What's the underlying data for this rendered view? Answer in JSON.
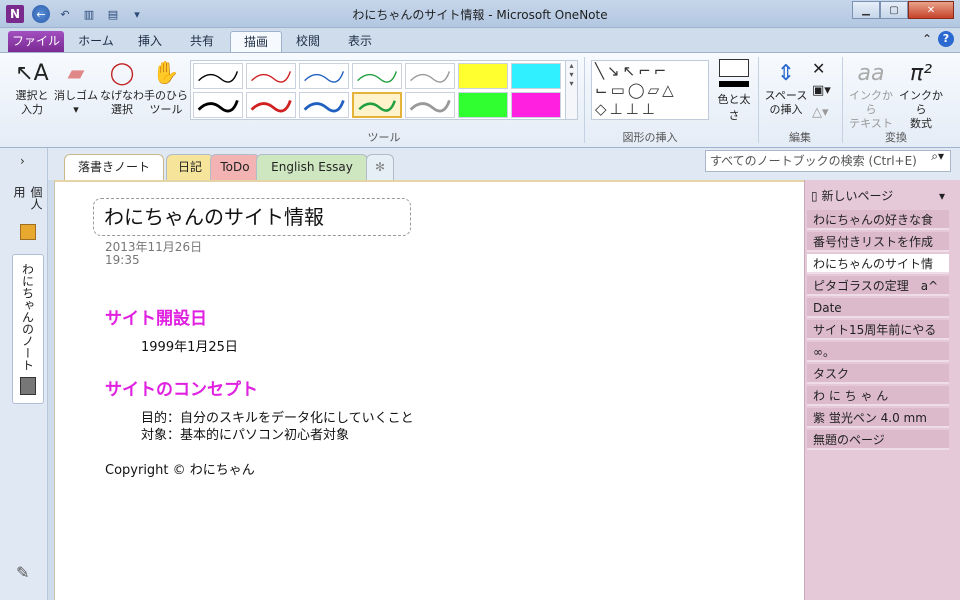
{
  "window": {
    "title": "わにちゃんのサイト情報 - Microsoft OneNote",
    "app_badge": "N"
  },
  "ribbon_tabs": [
    "ファイル",
    "ホーム",
    "挿入",
    "共有",
    "描画",
    "校閲",
    "表示"
  ],
  "active_tab": "描画",
  "ribbon": {
    "select_label": "選択と\n入力",
    "eraser_label": "消しゴム",
    "lasso_label": "なげなわ\n選択",
    "pan_label": "手のひら\nツール",
    "tools_group": "ツール",
    "color_width_label": "色と太さ",
    "shapes_group": "図形の挿入",
    "insert_space_label": "スペース\nの挿入",
    "edit_group": "編集",
    "ink_to_text_label": "インクから\nテキスト",
    "ink_to_math_label": "インクから\n数式",
    "convert_group": "変換"
  },
  "notebooks": {
    "personal": "個人用",
    "current": "わにちゃんのノート"
  },
  "section_tabs": [
    "落書きノート",
    "日記",
    "ToDo",
    "English Essay"
  ],
  "search": {
    "placeholder": "すべてのノートブックの検索 (Ctrl+E)"
  },
  "page": {
    "title": "わにちゃんのサイト情報",
    "date": "2013年11月26日",
    "time": "19:35",
    "heading1": "サイト開設日",
    "date_open": "1999年1月25日",
    "heading2": "サイトのコンセプト",
    "purpose": "目的：自分のスキルをデータ化にしていくこと",
    "target": "対象：基本的にパソコン初心者対象",
    "copyright": "Copyright © わにちゃん"
  },
  "pages_pane": {
    "new_page": "新しいページ",
    "items": [
      "わにちゃんの好きな食",
      "番号付きリストを作成",
      "わにちゃんのサイト情",
      "ピタゴラスの定理　a^",
      "Date",
      "サイト15周年前にやる",
      "∞。",
      "タスク",
      "わ に ち ゃ ん",
      "紫 蛍光ペン 4.0 mm",
      "無題のページ"
    ]
  },
  "colors": {
    "accent": "#7a2a93",
    "heading": "#e020e0"
  }
}
